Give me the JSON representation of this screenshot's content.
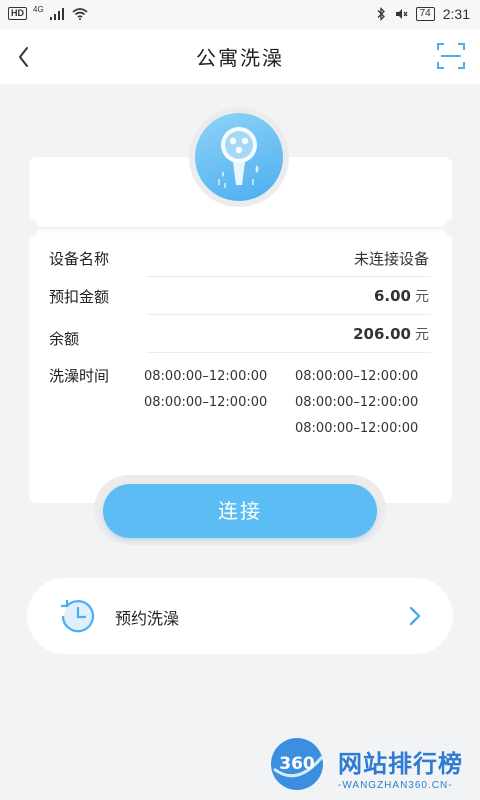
{
  "status_bar": {
    "hd": "HD",
    "network": "4G",
    "battery": "74",
    "time": "2:31"
  },
  "nav": {
    "title": "公寓洗澡",
    "back_icon": "chevron-left-icon",
    "scan_icon": "scan-icon"
  },
  "card": {
    "device_label": "设备名称",
    "device_value": "未连接设备",
    "prepay_label": "预扣金额",
    "prepay_amount": "6.00",
    "prepay_unit": "元",
    "balance_label": "余额",
    "balance_amount": "206.00",
    "balance_unit": "元",
    "time_label": "洗澡时间",
    "times": [
      "08:00:00–12:00:00",
      "08:00:00–12:00:00",
      "08:00:00–12:00:00",
      "08:00:00–12:00:00",
      "08:00:00–12:00:00"
    ]
  },
  "connect_button": "连接",
  "booking": {
    "label": "预约洗澡",
    "icon": "clock-history-icon"
  },
  "watermark": {
    "logo_text": "360",
    "title": "网站排行榜",
    "subtitle": "-WANGZHAN360.CN-"
  },
  "colors": {
    "accent": "#5cbcf4",
    "background": "#f2f3f5"
  }
}
